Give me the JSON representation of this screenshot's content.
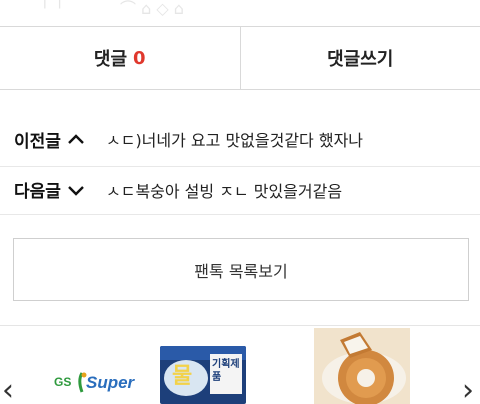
{
  "comments": {
    "label": "댓글",
    "count": "0",
    "write_label": "댓글쓰기"
  },
  "post_nav": {
    "prev": {
      "label": "이전글",
      "title": "ㅅㄷ)너네가 요고 맛없을것같다 했자나"
    },
    "next": {
      "label": "다음글",
      "title": "ㅅㄷ복숭아 설빙 ㅈㄴ 맛있을거같음"
    }
  },
  "list_button": {
    "label": "팬톡 목록보기"
  },
  "ads": {
    "logo_gs": "GS",
    "logo_super": "Super",
    "product_text_top": "물",
    "product_text_right": "기획제품"
  },
  "colors": {
    "comment_count": "#e0382d",
    "gs_green": "#2f9a3e",
    "gs_blue": "#2a6ebd",
    "product_navy": "#1d3f7a"
  },
  "icons": {
    "prev": "chevron-up-icon",
    "next": "chevron-down-icon",
    "carousel_left": "chevron-left-icon",
    "carousel_right": "chevron-right-icon"
  }
}
